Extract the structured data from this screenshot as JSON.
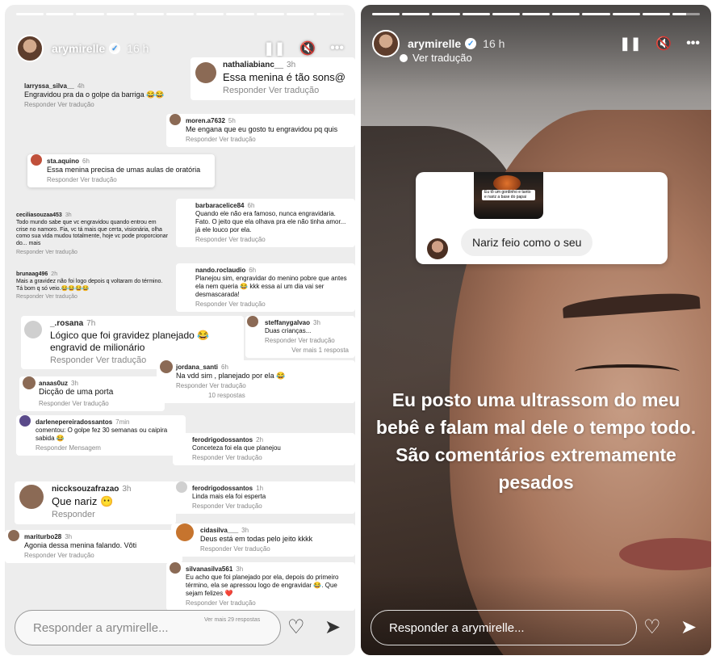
{
  "left_story": {
    "username": "arymirelle",
    "time": "16 h",
    "reply_placeholder": "Responder a arymirelle...",
    "comments": [
      {
        "user": "larryssa_silva__",
        "time": "4h",
        "text": "Engravidou pra da o golpe da barriga 😂😂",
        "actions": "Responder   Ver tradução"
      },
      {
        "user": "nathaliabianc__",
        "time": "3h",
        "text": "Essa menina é tão sons@",
        "actions": "Responder   Ver tradução"
      },
      {
        "user": "moren.a7632",
        "time": "5h",
        "text": "Me engana que eu gosto tu engravidou pq quis",
        "actions": "Responder   Ver tradução"
      },
      {
        "user": "sta.aquino",
        "time": "6h",
        "text": "Essa menina precisa de umas aulas de oratória",
        "actions": "Responder   Ver tradução"
      },
      {
        "user": "barbaracelice84",
        "time": "6h",
        "text": "Quando ele não era famoso, nunca engravidaria. Fato. O jeito que ela olhava pra ele não tinha amor... já ele louco por ela.",
        "actions": "Responder   Ver tradução"
      },
      {
        "user": "ceciliasouzaa453",
        "time": "3h",
        "text": "Todo mundo sabe que vc engravidou quando entrou em crise no namoro. Fia, vc tá mais que certa, visionária, olha como sua vida mudou totalmente, hoje vc pode proporcionar do... mais",
        "actions": "Responder   Ver tradução"
      },
      {
        "user": "nando.roclaudio",
        "time": "6h",
        "text": "Planejou sim, engravidar do menino pobre que antes ela nem queria 😂 kkk essa aí um dia vai ser desmascarada!",
        "actions": "Responder   Ver tradução"
      },
      {
        "user": "brunaag496",
        "time": "2h",
        "text": "Mais a gravidez não foi logo depois q voltaram do término. Tá bom q só veio.😂😂😂😂",
        "actions": "Responder   Ver tradução"
      },
      {
        "user": "_.rosana",
        "time": "7h",
        "text": "Lógico que foi gravidez planejado 😂 engravid de milionário",
        "actions": "Responder   Ver tradução"
      },
      {
        "user": "steffanygalvao",
        "time": "3h",
        "text": "Duas crianças...",
        "actions": "Responder   Ver tradução",
        "extra": "Ver mais 1 resposta"
      },
      {
        "user": "jordana_santi",
        "time": "6h",
        "text": "Na vdd sim , planejado por ela 😂",
        "actions": "Responder   Ver tradução",
        "extra": "10 respostas"
      },
      {
        "user": "anaas0uz",
        "time": "3h",
        "text": "Dicção de uma porta",
        "actions": "Responder   Ver tradução"
      },
      {
        "user": "darlenepereiradossantos",
        "time": "7min",
        "text": "comentou: O golpe fez 30 semanas ou caipira sabida 😂",
        "actions": "Responder   Mensagem"
      },
      {
        "user": "ferodrigodossantos",
        "time": "2h",
        "text": "Conceteza foi ela que planejou",
        "actions": "Responder   Ver tradução"
      },
      {
        "user": "niccksouzafrazao",
        "time": "3h",
        "text": "Que nariz 😶",
        "actions": "Responder"
      },
      {
        "user": "ferodrigodossantos",
        "time": "1h",
        "text": "Linda mais ela foi esperta",
        "actions": "Responder   Ver tradução"
      },
      {
        "user": "mariturbo28",
        "time": "3h",
        "text": "Agonia dessa menina falando. Vôti",
        "actions": "Responder   Ver tradução"
      },
      {
        "user": "cidasilva___",
        "time": "3h",
        "text": "Deus está em todas pelo jeito kkkk",
        "actions": "Responder   Ver tradução"
      },
      {
        "user": "silvanasilva561",
        "time": "3h",
        "text": "Eu acho que foi planejado por ela, depois do primeiro término, ela se apressou logo de engravidar 😂. Que sejam felizes ❤️",
        "actions": "Responder   Ver tradução",
        "extra": "Ver mais 29 respostas"
      }
    ]
  },
  "right_story": {
    "username": "arymirelle",
    "time": "16 h",
    "translate": "Ver tradução",
    "thumb_text": "Eu tô um gordinho e tanto e nariz a base do papai",
    "comment": "Nariz feio como o seu",
    "caption": "Eu posto uma ultrassom do meu bebê e falam mal dele o tempo todo. São comentários extremamente pesados",
    "reply_placeholder": "Responder a arymirelle...",
    "progress": [
      1,
      1,
      1,
      1,
      1,
      1,
      1,
      1,
      1,
      1,
      0.5
    ]
  },
  "icons": {
    "pause": "pause-icon",
    "mute": "mute-icon",
    "more": "more-icon",
    "heart": "heart-icon",
    "send": "send-icon",
    "verified": "verified-badge"
  }
}
